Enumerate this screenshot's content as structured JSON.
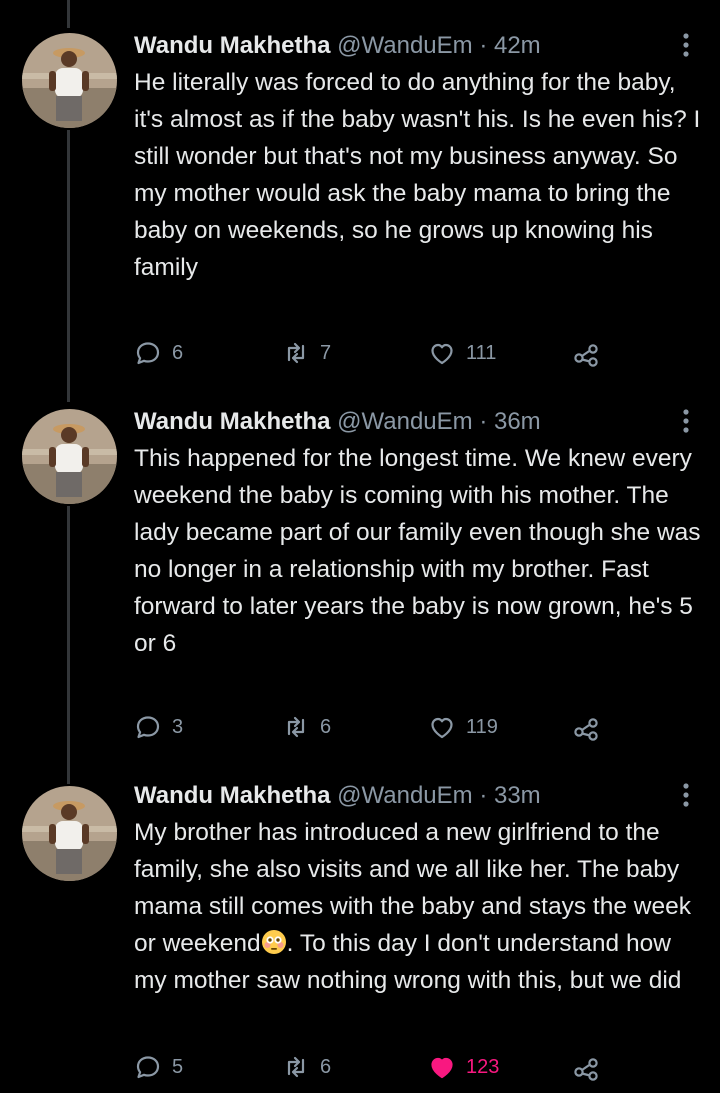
{
  "colors": {
    "background": "#000000",
    "text": "#e7e9ea",
    "secondary": "#8b98a5",
    "like_active": "#f91880",
    "thread_line": "#333639"
  },
  "tweets": [
    {
      "author": "Wandu Makhetha",
      "handle": "@WanduEm",
      "separator": "·",
      "time": "42m",
      "text": "He literally was forced to do anything for the baby, it's almost as if the baby wasn't his. Is he even his? I still wonder but that's not my business anyway. So my mother would ask the baby mama to bring the baby on weekends, so he grows up knowing his family",
      "replies": "6",
      "retweets": "7",
      "likes": "111",
      "liked": false
    },
    {
      "author": "Wandu Makhetha",
      "handle": "@WanduEm",
      "separator": "·",
      "time": "36m",
      "text": "This happened for the longest time. We knew every weekend the baby is coming with his mother. The lady became part of our family even though she was no longer in a relationship with my brother. Fast forward to later years the baby is now grown, he's 5 or 6",
      "replies": "3",
      "retweets": "6",
      "likes": "119",
      "liked": false
    },
    {
      "author": "Wandu Makhetha",
      "handle": "@WanduEm",
      "separator": "·",
      "time": "33m",
      "text_before_emoji": "My brother has introduced a new girlfriend to the family, she also visits and we all like her. The baby mama still comes with the baby and stays the week or weekend",
      "emoji": "flushed-face",
      "text_after_emoji": ". To this day I don't understand how my mother saw nothing wrong with this, but we did",
      "replies": "5",
      "retweets": "6",
      "likes": "123",
      "liked": true
    }
  ]
}
